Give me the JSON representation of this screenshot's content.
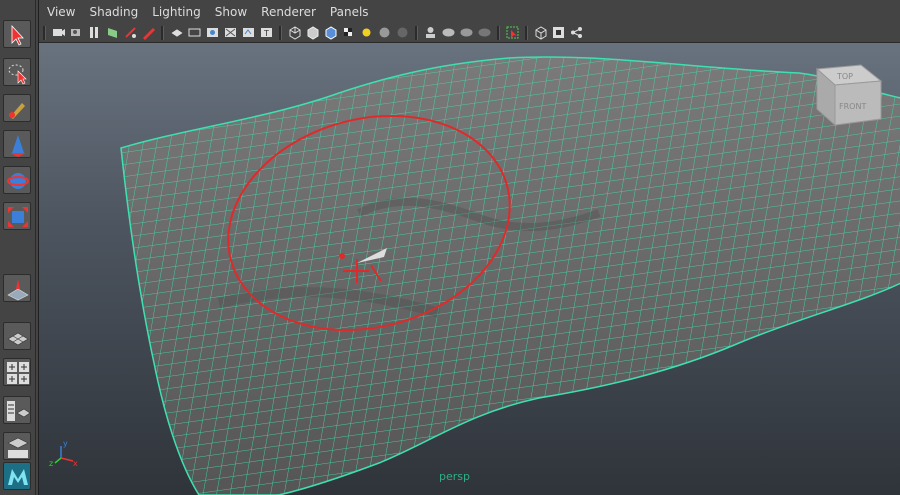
{
  "menubar": {
    "items": [
      "View",
      "Shading",
      "Lighting",
      "Show",
      "Renderer",
      "Panels"
    ]
  },
  "viewcube": {
    "top_label": "TOP",
    "front_label": "FRONT"
  },
  "camera_label": "persp",
  "axis_gizmo": {
    "x": "x",
    "y": "y",
    "z": "z"
  },
  "colors": {
    "wireframe": "#3fe0b0",
    "surface": "#6a6a6a",
    "brush_ring": "#e02a2a",
    "ui_panel": "#444444"
  },
  "toolbox": {
    "tools": [
      "select-tool",
      "lasso-tool",
      "paint-tool",
      "move-tool",
      "rotate-tool",
      "scale-tool",
      "sculpt-tool",
      "single-layout",
      "four-layout",
      "outliner-layout",
      "graph-layout",
      "maya-logo"
    ]
  }
}
